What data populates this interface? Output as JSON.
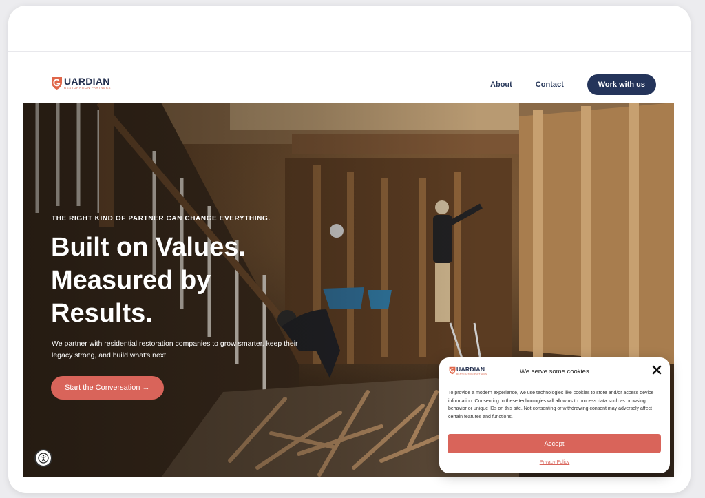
{
  "brand": {
    "name": "UARDIAN",
    "tagline": "RESTORATION PARTNERS",
    "mark_color": "#e0674a",
    "primary_color": "#24345a",
    "accent_color": "#d9645a"
  },
  "nav": {
    "items": [
      {
        "label": "About"
      },
      {
        "label": "Contact"
      }
    ],
    "cta_label": "Work with us"
  },
  "hero": {
    "eyebrow": "THE RIGHT KIND OF PARTNER CAN CHANGE EVERYTHING.",
    "headline": [
      "Built on Values.",
      "Measured by",
      "Results."
    ],
    "lede": "We partner with residential restoration companies to grow smarter, keep their legacy strong, and build what's next.",
    "cta_label": "Start the Conversation →",
    "image_subject": "restoration workers clearing debris in a gutted house interior"
  },
  "accessibility": {
    "icon": "accessibility-icon"
  },
  "cookie_banner": {
    "title": "We serve some cookies",
    "body": "To provide a modern experience, we use technologies like cookies to store and/or access device information. Consenting to these technologies will allow us to process data such as browsing behavior or unique IDs on this site. Not consenting or withdrawing consent may adversely affect certain features and functions.",
    "accept_label": "Accept",
    "policy_label": "Privacy Policy",
    "close_icon": "close-icon"
  }
}
